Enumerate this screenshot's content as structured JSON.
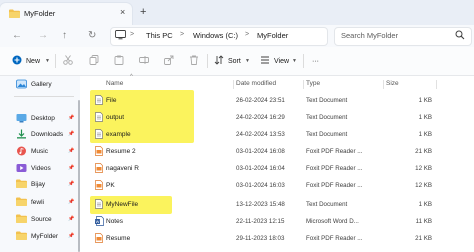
{
  "tab": {
    "title": "MyFolder",
    "close": "×",
    "add": "+"
  },
  "nav": {
    "back": "←",
    "forward": "→",
    "up": "↑",
    "refresh": "↻"
  },
  "address": {
    "crumbs": [
      "This PC",
      "Windows (C:)",
      "MyFolder"
    ],
    "separator": ">"
  },
  "search": {
    "placeholder": "Search MyFolder"
  },
  "commands": {
    "new": "New",
    "sort": "Sort",
    "view": "View",
    "more": "···"
  },
  "sidebar": {
    "items": [
      {
        "label": "Gallery",
        "icon": "gallery-icon",
        "pinned": false
      },
      {
        "label": "Desktop",
        "icon": "desktop-icon",
        "pinned": true
      },
      {
        "label": "Downloads",
        "icon": "downloads-icon",
        "pinned": true
      },
      {
        "label": "Music",
        "icon": "music-icon",
        "pinned": true
      },
      {
        "label": "Videos",
        "icon": "videos-icon",
        "pinned": true
      },
      {
        "label": "Bijay",
        "icon": "folder-icon",
        "pinned": true
      },
      {
        "label": "fewli",
        "icon": "folder-icon",
        "pinned": true
      },
      {
        "label": "Source",
        "icon": "folder-icon",
        "pinned": true
      },
      {
        "label": "MyFolder",
        "icon": "folder-icon",
        "pinned": true
      }
    ]
  },
  "columns": {
    "name": "Name",
    "date": "Date modified",
    "type": "Type",
    "size": "Size"
  },
  "files": [
    {
      "name": "File",
      "date": "26-02-2024 23:51",
      "type": "Text Document",
      "size": "1 KB",
      "icon": "text-file-icon"
    },
    {
      "name": "output",
      "date": "24-02-2024 16:29",
      "type": "Text Document",
      "size": "1 KB",
      "icon": "text-file-icon"
    },
    {
      "name": "example",
      "date": "24-02-2024 13:53",
      "type": "Text Document",
      "size": "1 KB",
      "icon": "text-file-icon"
    },
    {
      "name": "Resume 2",
      "date": "03-01-2024 16:08",
      "type": "Foxit PDF Reader ...",
      "size": "21 KB",
      "icon": "pdf-file-icon"
    },
    {
      "name": "nagaveni R",
      "date": "03-01-2024 16:04",
      "type": "Foxit PDF Reader ...",
      "size": "12 KB",
      "icon": "pdf-file-icon"
    },
    {
      "name": "PK",
      "date": "03-01-2024 16:03",
      "type": "Foxit PDF Reader ...",
      "size": "12 KB",
      "icon": "pdf-file-icon"
    },
    {
      "name": "MyNewFile",
      "date": "13-12-2023 15:48",
      "type": "Text Document",
      "size": "1 KB",
      "icon": "text-file-icon"
    },
    {
      "name": "Notes",
      "date": "22-11-2023 12:15",
      "type": "Microsoft Word D...",
      "size": "11 KB",
      "icon": "word-file-icon"
    },
    {
      "name": "Resume",
      "date": "29-11-2023 18:03",
      "type": "Foxit PDF Reader ...",
      "size": "21 KB",
      "icon": "pdf-file-icon"
    }
  ],
  "colors": {
    "highlight": "#fbf35d",
    "folder": "#f2c14e",
    "accent": "#0067c0"
  }
}
